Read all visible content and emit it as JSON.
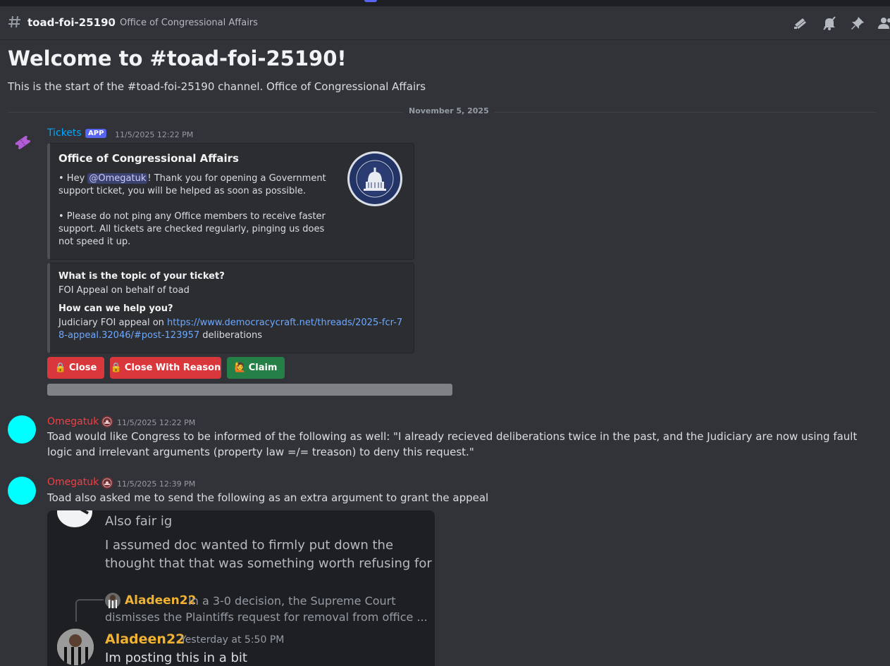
{
  "header": {
    "channel_name": "toad-foi-25190",
    "topic": "Office of Congressional Affairs",
    "icons": [
      "threads-icon",
      "mute-bell-icon",
      "pin-icon",
      "members-icon"
    ]
  },
  "welcome": {
    "title": "Welcome to #toad-foi-25190!",
    "subtitle": "This is the start of the #toad-foi-25190 channel. Office of Congressional Affairs"
  },
  "date_divider": "November 5, 2025",
  "messages": {
    "bot": {
      "author": "Tickets",
      "tag": "APP",
      "timestamp": "11/5/2025 12:22 PM",
      "author_color": "#00a8fc",
      "embed": {
        "title": "Office of Congressional Affairs",
        "line1_pre": "• Hey ",
        "mention": "@Omegatuk",
        "line1_post": "! Thank you for opening a Government support ticket, you will be helped as soon as possible.",
        "line2": "• Please do not ping any Office members to receive faster support. All tickets are checked regularly, pinging us does not speed it up."
      },
      "fields": {
        "q1": "What is the topic of your ticket?",
        "a1": "FOI Appeal on behalf of toad",
        "q2": "How can we help you?",
        "a2_pre": "Judiciary FOI appeal on ",
        "a2_link": "https://www.democracycraft.net/threads/2025-fcr-78-appeal.32046/#post-123957",
        "a2_post": " deliberations"
      },
      "buttons": {
        "close": "Close",
        "close_reason": "Close With Reason",
        "claim": "Claim"
      }
    },
    "m1": {
      "author": "Omegatuk",
      "timestamp": "11/5/2025 12:22 PM",
      "author_color": "#f23f43",
      "text": "Toad would like Congress to be informed of the following as well: \"I already recieved deliberations twice in the past, and the Judiciary are now using fault logic and irrelevant arguments (property law =/= treason) to deny this request.\""
    },
    "m2": {
      "author": "Omegatuk",
      "timestamp": "11/5/2025 12:39 PM",
      "author_color": "#f23f43",
      "text": "Toad also asked me to send the following as an extra argument to grant the appeal"
    }
  },
  "attachment": {
    "line1": "Also fair ig",
    "line2": "I assumed doc wanted to firmly put down the",
    "line3": "thought that that was something worth refusing for",
    "reply_name": "Aladeen22",
    "reply_text1": "In a 3-0 decision, the Supreme Court",
    "reply_text2": "dismisses the Plaintiffs request for removal from office ...",
    "author": "Aladeen22",
    "timestamp": "Yesterday at 5:50 PM",
    "text": "Im posting this in a bit"
  }
}
